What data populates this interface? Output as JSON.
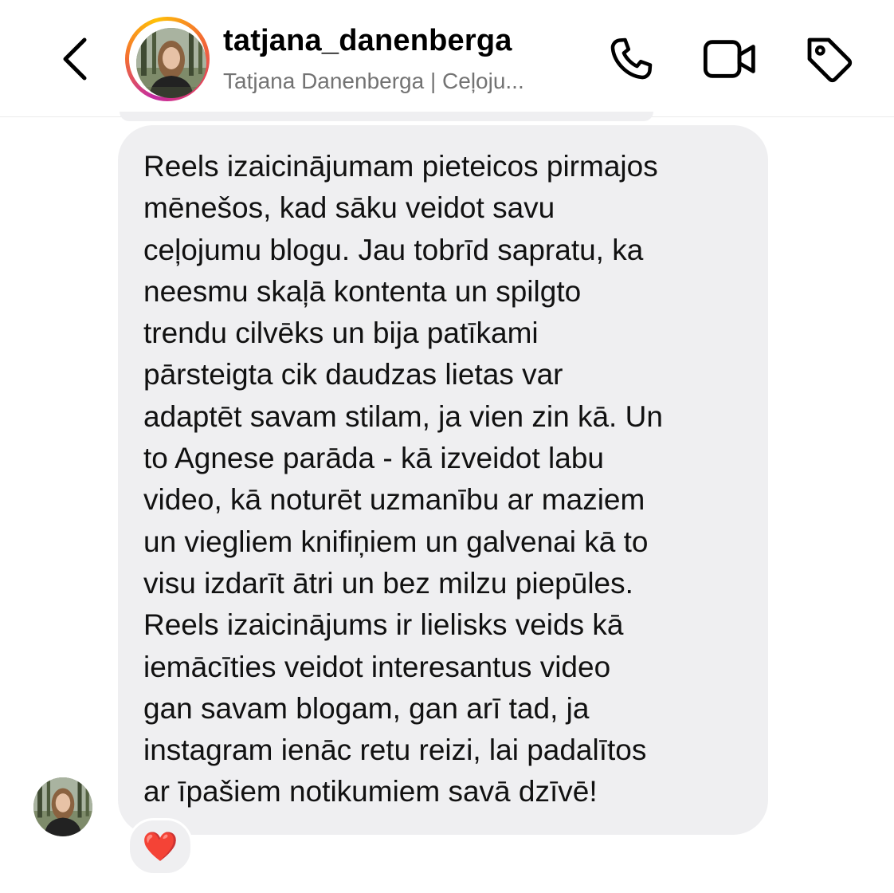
{
  "header": {
    "username": "tatjana_danenberga",
    "subtitle": "Tatjana Danenberga | Ceļoju...",
    "back_icon": "chevron-left-icon",
    "call_icon": "phone-icon",
    "video_icon": "video-camera-icon",
    "tag_icon": "tag-icon"
  },
  "message": {
    "text": "Reels izaicinājumam pieteicos pirmajos\nmēnešos, kad sāku veidot savu\nceļojumu blogu. Jau tobrīd sapratu, ka\nneesmu skaļā kontenta un spilgto\ntrendu cilvēks un bija patīkami\npārsteigta cik daudzas lietas var\nadaptēt savam stilam, ja vien zin kā. Un\nto Agnese parāda - kā izveidot labu\nvideo, kā noturēt uzmanību ar maziem\nun viegliem knifiņiem un galvenai kā to\nvisu izdarīt ātri un bez milzu piepūles.\nReels izaicinājums ir lielisks veids kā\niemācīties veidot interesantus video\ngan savam blogam, gan arī tad, ja\ninstagram ienāc retu reizi, lai padalītos\nar īpašiem notikumiem savā dzīvē!",
    "reaction": "❤️"
  },
  "colors": {
    "bubble_bg": "#efeff1",
    "subtitle_gray": "#737373",
    "reaction_red": "#e3173f"
  }
}
